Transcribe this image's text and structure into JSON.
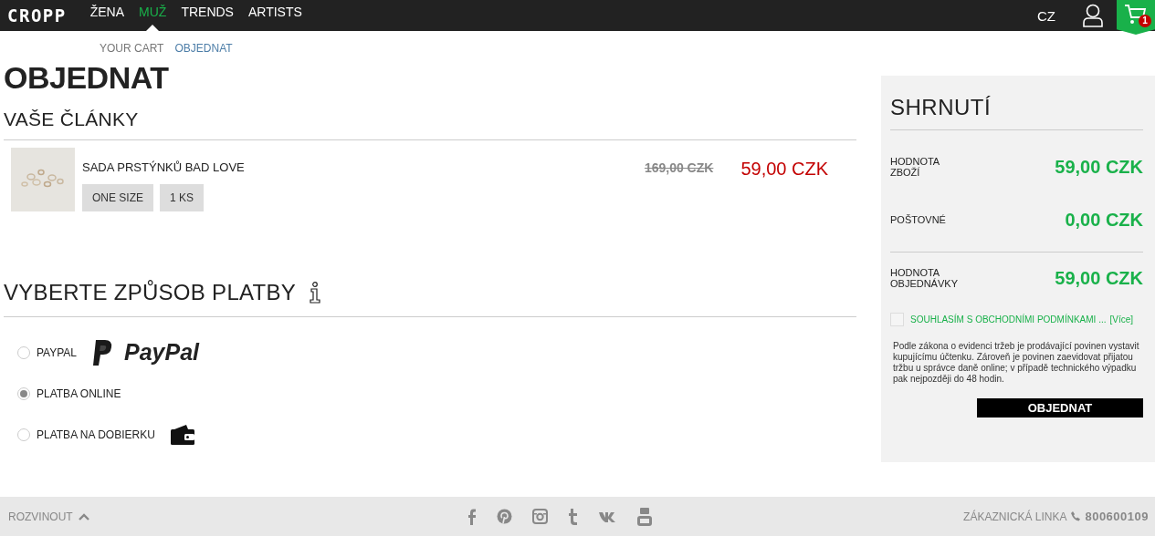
{
  "header": {
    "logo": "CROPP",
    "nav": [
      {
        "label": "ŽENA",
        "selected": false
      },
      {
        "label": "MUŽ",
        "selected": true
      },
      {
        "label": "TRENDS",
        "selected": false
      },
      {
        "label": "ARTISTS",
        "selected": false
      }
    ],
    "language": "CZ",
    "cart_count": "1"
  },
  "breadcrumb": [
    {
      "label": "YOUR CART",
      "selected": false
    },
    {
      "label": "OBJEDNAT",
      "selected": true
    }
  ],
  "title": "OBJEDNAT",
  "articles": {
    "heading": "VAŠE ČLÁNKY",
    "items": [
      {
        "name": "SADA PRSTÝNKŮ BAD LOVE",
        "size": "ONE SIZE",
        "quantity": "1 KS",
        "old_price": "169,00 CZK",
        "price": "59,00 CZK"
      }
    ]
  },
  "payment": {
    "heading": "VYBERTE ZPŮSOB PLATBY",
    "options": [
      {
        "label": "PAYPAL",
        "selected": false,
        "kind": "paypal",
        "logo_text": "PayPal"
      },
      {
        "label": "PLATBA ONLINE",
        "selected": true,
        "kind": "none"
      },
      {
        "label": "PLATBA NA DOBIERKU",
        "selected": false,
        "kind": "wallet"
      }
    ]
  },
  "summary": {
    "heading": "SHRNUTÍ",
    "rows": [
      {
        "label": "HODNOTA ZBOŽÍ",
        "value": "59,00 CZK"
      },
      {
        "label": "POŠTOVNÉ",
        "value": "0,00 CZK"
      },
      {
        "label": "HODNOTA OBJEDNÁVKY",
        "value": "59,00 CZK"
      }
    ],
    "terms": {
      "label": "SOUHLASÍM S OBCHODNÍMI PODMÍNKAMI ...",
      "link": "[Více]",
      "checked": false
    },
    "notice": "Podle zákona o evidenci tržeb je prodávající povinen vystavit kupujícímu účtenku. Zároveň je povinen zaevidovat přijatou tržbu u správce daně online; v případě technického výpadku pak nejpozději do 48 hodin.",
    "button": "OBJEDNAT"
  },
  "footer": {
    "expand": "ROZVINOUT",
    "hotline_label": "ZÁKAZNICKÁ LINKA",
    "hotline_number": "800600109"
  }
}
